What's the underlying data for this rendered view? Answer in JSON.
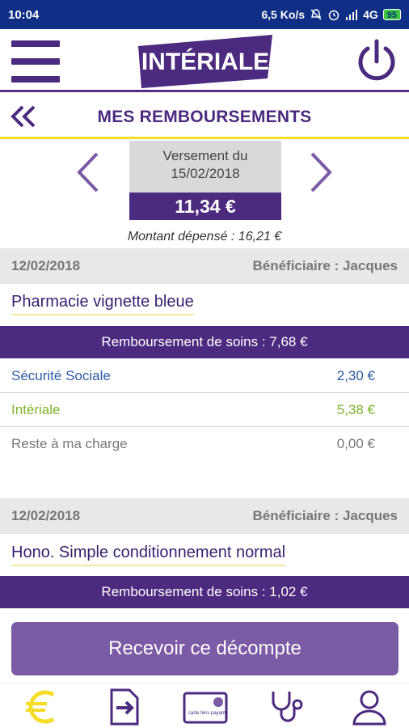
{
  "status_bar": {
    "time": "10:04",
    "network_speed": "6,5 Ko/s",
    "network_type": "4G",
    "battery": "95"
  },
  "app_bar": {
    "logo_text": "INTÉRIALE",
    "brand_color": "#4c2a80",
    "accent_color": "#f4dc27"
  },
  "header": {
    "title": "MES REMBOURSEMENTS"
  },
  "payment": {
    "label_line1": "Versement du",
    "label_line2": "15/02/2018",
    "amount": "11,34 €",
    "spent": "Montant dépensé : 16,21 €"
  },
  "entries": [
    {
      "date": "12/02/2018",
      "beneficiary": "Bénéficiaire : Jacques",
      "act": "Pharmacie vignette bleue",
      "reimbursement": "Remboursement de soins : 7,68 €",
      "details": [
        {
          "label": "Sécurité Sociale",
          "value": "2,30 €"
        },
        {
          "label": "Intériale",
          "value": "5,38 €"
        },
        {
          "label": "Reste à ma charge",
          "value": "0,00 €"
        }
      ]
    },
    {
      "date": "12/02/2018",
      "beneficiary": "Bénéficiaire : Jacques",
      "act": "Hono. Simple conditionnement normal",
      "reimbursement": "Remboursement de soins : 1,02 €"
    }
  ],
  "cta": {
    "label": "Recevoir ce décompte"
  },
  "bottom_nav": {
    "items": [
      "euro-icon",
      "document-arrow-icon",
      "card-icon",
      "stethoscope-icon",
      "user-icon"
    ],
    "card_text": "carte tiers payant"
  }
}
